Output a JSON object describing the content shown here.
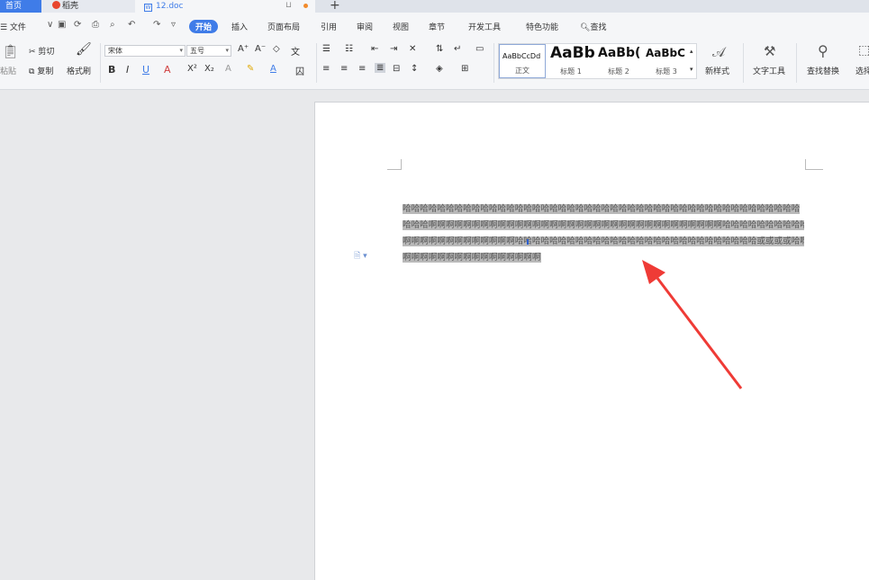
{
  "tabs": {
    "home": "首页",
    "daoke": "稻壳",
    "doc": "12.doc"
  },
  "menu": {
    "file": "☰ 文件",
    "items": [
      "开始",
      "插入",
      "页面布局",
      "引用",
      "审阅",
      "视图",
      "章节",
      "开发工具",
      "特色功能"
    ],
    "search": "查找"
  },
  "ribbon": {
    "paste": "粘贴",
    "cut": "剪切",
    "copy": "复制",
    "format_painter": "格式刷",
    "font_name": "宋体",
    "font_size": "五号",
    "new_style": "新样式",
    "text_tools": "文字工具",
    "find_replace": "查找替换",
    "select": "选择",
    "styles": [
      {
        "sample": "AaBbCcDd",
        "name": "正文"
      },
      {
        "sample": "AaBb",
        "name": "标题 1"
      },
      {
        "sample": "AaBb(",
        "name": "标题 2"
      },
      {
        "sample": "AaBbC",
        "name": "标题 3"
      }
    ]
  },
  "document": {
    "lines": [
      "哈哈哈哈哈哈哈哈哈哈哈哈哈哈哈哈哈哈哈哈哈哈哈哈哈哈哈哈哈哈哈哈哈哈哈哈哈哈哈哈哈哈哈哈哈哈",
      "哈哈哈啊啊啊啊啊啊啊啊啊啊啊啊啊啊啊啊啊啊啊啊啊啊啊啊啊啊啊啊啊啊啊啊啊啊哈哈哈哈哈哈哈哈哈哈哈哈",
      "啊啊啊啊啊啊啊啊啊啊啊啊啊哈哈哈哈哈哈哈哈哈哈哈哈哈哈哈哈哈哈哈哈哈哈哈哈哈哈哈哈或或或或哈啊",
      "啊啊啊啊啊啊啊啊啊啊啊啊啊啊啊啊"
    ]
  },
  "colors": {
    "accent": "#3f7ce8",
    "arrow": "#ef3b36",
    "selection": "#b9b9b9"
  }
}
